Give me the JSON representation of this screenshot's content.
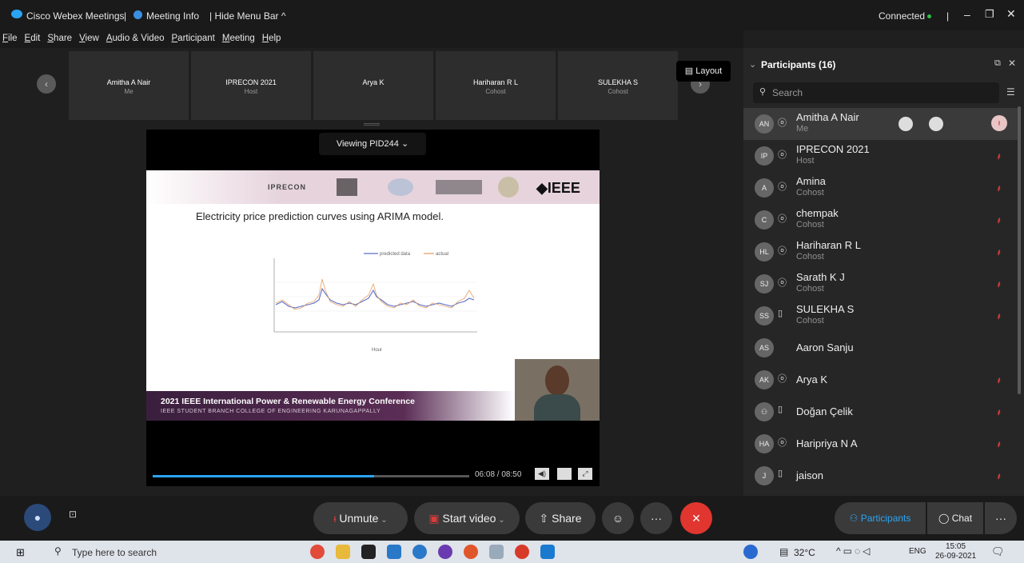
{
  "titlebar": {
    "app": "Cisco Webex Meetings",
    "sep": "|",
    "meeting_info": "Meeting Info",
    "hide_menu": "| Hide Menu Bar ^",
    "status": "Connected",
    "status_sep": "|"
  },
  "menu": [
    "File",
    "Edit",
    "Share",
    "View",
    "Audio & Video",
    "Participant",
    "Meeting",
    "Help"
  ],
  "strip": {
    "tiles": [
      {
        "name": "Amitha A Nair",
        "sub": "Me"
      },
      {
        "name": "IPRECON 2021",
        "sub": "Host"
      },
      {
        "name": "Arya K",
        "sub": ""
      },
      {
        "name": "Hariharan R L",
        "sub": "Cohost"
      },
      {
        "name": "SULEKHA S",
        "sub": "Cohost"
      }
    ],
    "layout_label": "Layout"
  },
  "share": {
    "viewing": "Viewing PID244",
    "slide_title": "Electricity price prediction curves using ARIMA model.",
    "footer_title": "2021 IEEE International Power & Renewable Energy Conference",
    "footer_sub": "IEEE STUDENT BRANCH COLLEGE OF ENGINEERING KARUNAGAPPALLY",
    "logos": [
      "IPRECON",
      "IEEE"
    ],
    "time": "06:08 / 08:50",
    "progress": 0.7
  },
  "chart_data": {
    "type": "line",
    "legend": [
      "predicted data",
      "actual"
    ],
    "xlabel": "Hour",
    "series": [
      {
        "values": []
      },
      {
        "values": []
      }
    ]
  },
  "panel": {
    "title": "Participants (16)",
    "search_placeholder": "Search",
    "participants": [
      {
        "initials": "AN",
        "name": "Amitha A Nair",
        "role": "Me"
      },
      {
        "initials": "IP",
        "name": "IPRECON 2021",
        "role": "Host"
      },
      {
        "initials": "A",
        "name": "Amina",
        "role": "Cohost"
      },
      {
        "initials": "C",
        "name": "chempak",
        "role": "Cohost"
      },
      {
        "initials": "HL",
        "name": "Hariharan R L",
        "role": "Cohost"
      },
      {
        "initials": "SJ",
        "name": "Sarath K J",
        "role": "Cohost"
      },
      {
        "initials": "SS",
        "name": "SULEKHA S",
        "role": "Cohost"
      },
      {
        "initials": "AS",
        "name": "Aaron Sanju",
        "role": ""
      },
      {
        "initials": "AK",
        "name": "Arya K",
        "role": ""
      },
      {
        "initials": "",
        "name": "Doğan Çelik",
        "role": ""
      },
      {
        "initials": "HA",
        "name": "Haripriya N A",
        "role": ""
      },
      {
        "initials": "J",
        "name": "jaison",
        "role": ""
      }
    ]
  },
  "controls": {
    "unmute": "Unmute",
    "start_video": "Start video",
    "share": "Share",
    "participants": "Participants",
    "chat": "Chat"
  },
  "taskbar": {
    "search_placeholder": "Type here to search",
    "weather": "32°C",
    "lang": "ENG",
    "time": "15:05",
    "date": "26-09-2021"
  }
}
